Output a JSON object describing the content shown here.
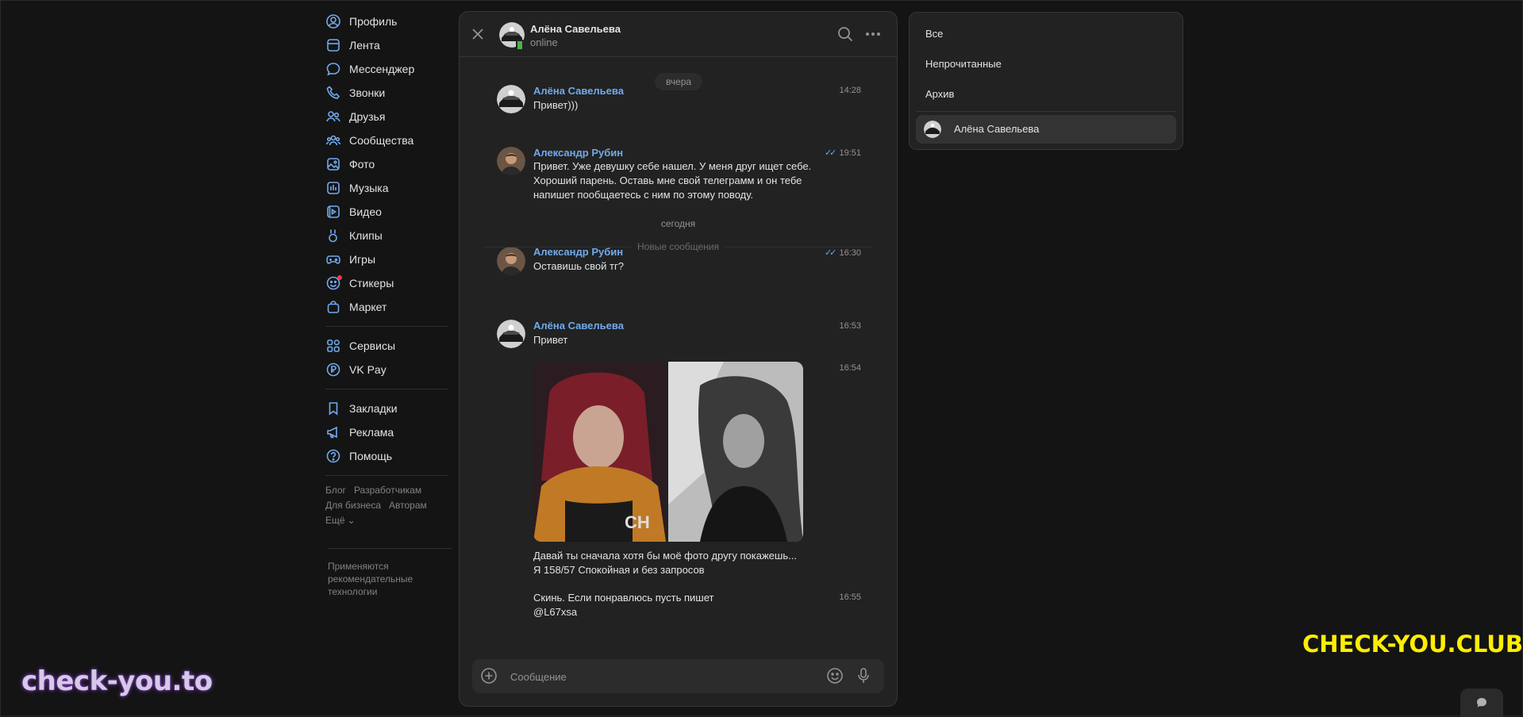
{
  "nav": {
    "items": [
      {
        "label": "Профиль",
        "icon": "user-circle-icon"
      },
      {
        "label": "Лента",
        "icon": "feed-icon"
      },
      {
        "label": "Мессенджер",
        "icon": "message-bubble-icon"
      },
      {
        "label": "Звонки",
        "icon": "phone-icon"
      },
      {
        "label": "Друзья",
        "icon": "friends-icon"
      },
      {
        "label": "Сообщества",
        "icon": "communities-icon"
      },
      {
        "label": "Фото",
        "icon": "photo-icon"
      },
      {
        "label": "Музыка",
        "icon": "music-icon"
      },
      {
        "label": "Видео",
        "icon": "video-icon"
      },
      {
        "label": "Клипы",
        "icon": "clips-icon"
      },
      {
        "label": "Игры",
        "icon": "gamepad-icon"
      },
      {
        "label": "Стикеры",
        "icon": "sticker-smile-icon"
      },
      {
        "label": "Маркет",
        "icon": "market-bag-icon"
      }
    ],
    "items2": [
      {
        "label": "Сервисы",
        "icon": "services-grid-icon"
      },
      {
        "label": "VK Pay",
        "icon": "vkpay-icon"
      }
    ],
    "items3": [
      {
        "label": "Закладки",
        "icon": "bookmark-icon"
      },
      {
        "label": "Реклама",
        "icon": "megaphone-icon"
      },
      {
        "label": "Помощь",
        "icon": "help-icon"
      }
    ],
    "footer_links": [
      "Блог",
      "Разработчикам",
      "Для бизнеса",
      "Авторам",
      "Ещё"
    ],
    "footer_note": "Применяются рекомендательные технологии"
  },
  "chat": {
    "header": {
      "name": "Алёна Савельева",
      "status": "online"
    },
    "dates": {
      "yesterday": "вчера",
      "today": "сегодня"
    },
    "new_messages_label": "Новые сообщения",
    "messages": [
      {
        "author": "Алёна Савельева",
        "time": "14:28",
        "lines": [
          "Привет)))"
        ]
      },
      {
        "author": "Александр Рубин",
        "time": "19:51",
        "lines": [
          "Привет. Уже девушку себе нашел. У меня друг ищет себе.",
          "Хороший парень. Оставь мне свой телеграмм и он тебе",
          "напишет пообщаетесь с ним по этому поводу."
        ]
      },
      {
        "author": "Александр Рубин",
        "time": "16:30",
        "lines": [
          "Оставишь свой тг?"
        ]
      },
      {
        "author": "Алёна Савельева",
        "time": "16:53",
        "lines": [
          "Привет"
        ]
      },
      {
        "time": "16:54",
        "lines": [
          "Давай ты сначала хотя бы моё фото другу покажешь...",
          "Я 158/57 Спокойная и без запросов"
        ]
      },
      {
        "time": "16:55",
        "lines": [
          "Скинь. Если понравлюсь пусть пишет",
          "@L67xsa"
        ]
      }
    ],
    "compose_placeholder": "Сообщение"
  },
  "folders": {
    "items": [
      "Все",
      "Непрочитанные",
      "Архив"
    ],
    "chat_item": "Алёна Савельева"
  },
  "watermarks": {
    "left": "check-you.to",
    "right": "CHECK-YOU.CLUB"
  },
  "colors": {
    "background": "#141414",
    "panel": "#222222",
    "accent": "#71aaeb",
    "online": "#4bb34b",
    "watermark_right": "#ffee00"
  }
}
